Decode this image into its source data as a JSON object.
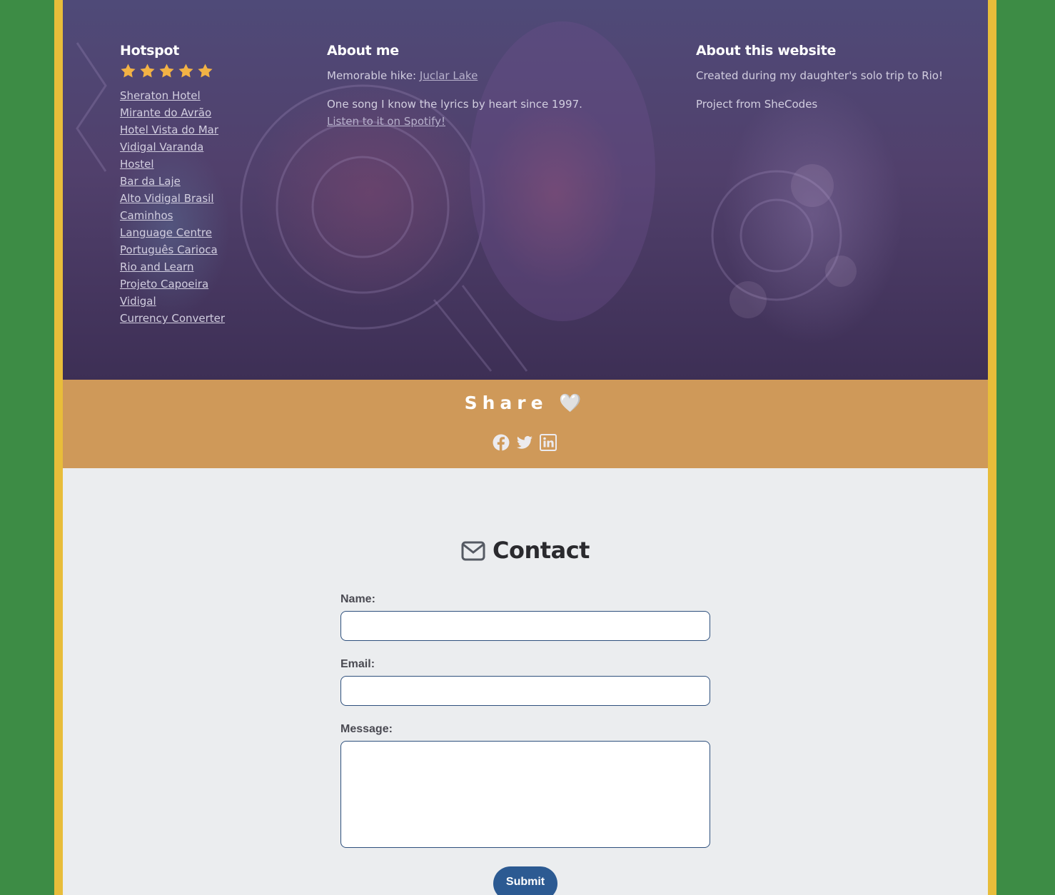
{
  "hotspot": {
    "title": "Hotspot",
    "rating": 5,
    "links": [
      "Sheraton Hotel",
      "Mirante do Avrão",
      "Hotel Vista do Mar",
      "Vidigal Varanda",
      "Hostel",
      "Bar da Laje",
      "Alto Vidigal Brasil",
      "Caminhos",
      "Language Centre",
      "Português Carioca",
      "Rio and Learn",
      "Projeto Capoeira",
      "Vidigal",
      "Currency Converter"
    ]
  },
  "about_me": {
    "title": "About me",
    "hike_prefix": "Memorable hike: ",
    "hike_link": "Juclar Lake",
    "song_text": "One song I know the lyrics by heart since 1997.",
    "song_link": "Listen to it on Spotify!"
  },
  "about_site": {
    "title": "About this website",
    "line1": "Created during my daughter's solo trip to Rio!",
    "line2": "Project from SheCodes"
  },
  "share": {
    "title": "Share 🤍",
    "icons": [
      "facebook-icon",
      "twitter-icon",
      "linkedin-icon"
    ]
  },
  "contact": {
    "title": "Contact",
    "name_label": "Name:",
    "email_label": "Email:",
    "message_label": "Message:",
    "submit_label": "Submit"
  },
  "colors": {
    "background": "#3d8c45",
    "frame": "#e8bd3a",
    "share_bar": "#cf9959",
    "submit": "#2c5a92",
    "star": "#f2b245"
  }
}
